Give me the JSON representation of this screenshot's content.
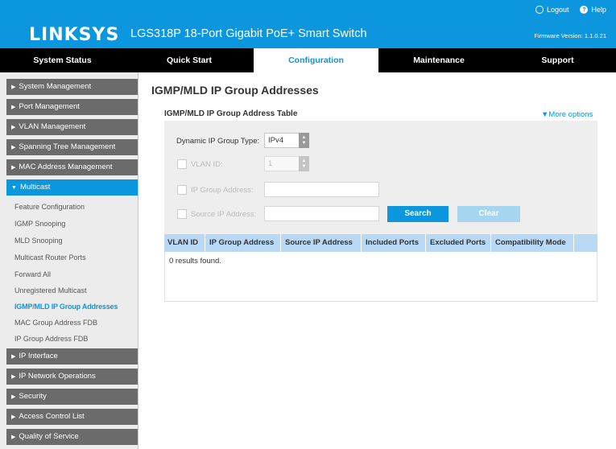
{
  "header": {
    "brand": "LINKSYS",
    "product": "LGS318P 18-Port Gigabit PoE+ Smart Switch",
    "logout_label": "Logout",
    "help_label": "Help",
    "firmware": "Firmware Version: 1.1.0.21",
    "accent_color": "#0b96dd"
  },
  "nav": {
    "tabs": [
      {
        "label": "System Status"
      },
      {
        "label": "Quick Start"
      },
      {
        "label": "Configuration",
        "active": true
      },
      {
        "label": "Maintenance"
      },
      {
        "label": "Support"
      }
    ]
  },
  "sidebar": {
    "sections": [
      {
        "label": "System Management"
      },
      {
        "label": "Port Management"
      },
      {
        "label": "VLAN Management"
      },
      {
        "label": "Spanning Tree Management"
      },
      {
        "label": "MAC Address Management"
      },
      {
        "label": "Multicast",
        "open": true
      },
      {
        "label": "IP Interface"
      },
      {
        "label": "IP Network Operations"
      },
      {
        "label": "Security"
      },
      {
        "label": "Access Control List"
      },
      {
        "label": "Quality of Service"
      }
    ],
    "multicast_items": [
      {
        "label": "Feature Configuration"
      },
      {
        "label": "IGMP Snooping"
      },
      {
        "label": "MLD Snooping"
      },
      {
        "label": "Multicast Router Ports"
      },
      {
        "label": "Forward All"
      },
      {
        "label": "Unregistered Multicast"
      },
      {
        "label": "IGMP/MLD IP Group Addresses",
        "active": true
      },
      {
        "label": "MAC Group Address FDB"
      },
      {
        "label": "IP Group Address FDB"
      }
    ]
  },
  "main": {
    "title": "IGMP/MLD IP Group Addresses",
    "table_title": "IGMP/MLD IP Group Address Table",
    "more_options": "▼More options",
    "filter": {
      "type_label": "Dynamic IP Group Type:",
      "type_value": "IPv4",
      "vlan_label": "VLAN ID:",
      "vlan_value": "1",
      "group_label": "IP Group Address:",
      "group_value": "",
      "source_label": "Source IP Address:",
      "source_value": "",
      "search_label": "Search",
      "clear_label": "Clear"
    },
    "columns": [
      "VLAN ID",
      "IP Group Address",
      "Source IP Address",
      "Included Ports",
      "Excluded Ports",
      "Compatibility Mode"
    ],
    "empty_message": "0 results found."
  }
}
